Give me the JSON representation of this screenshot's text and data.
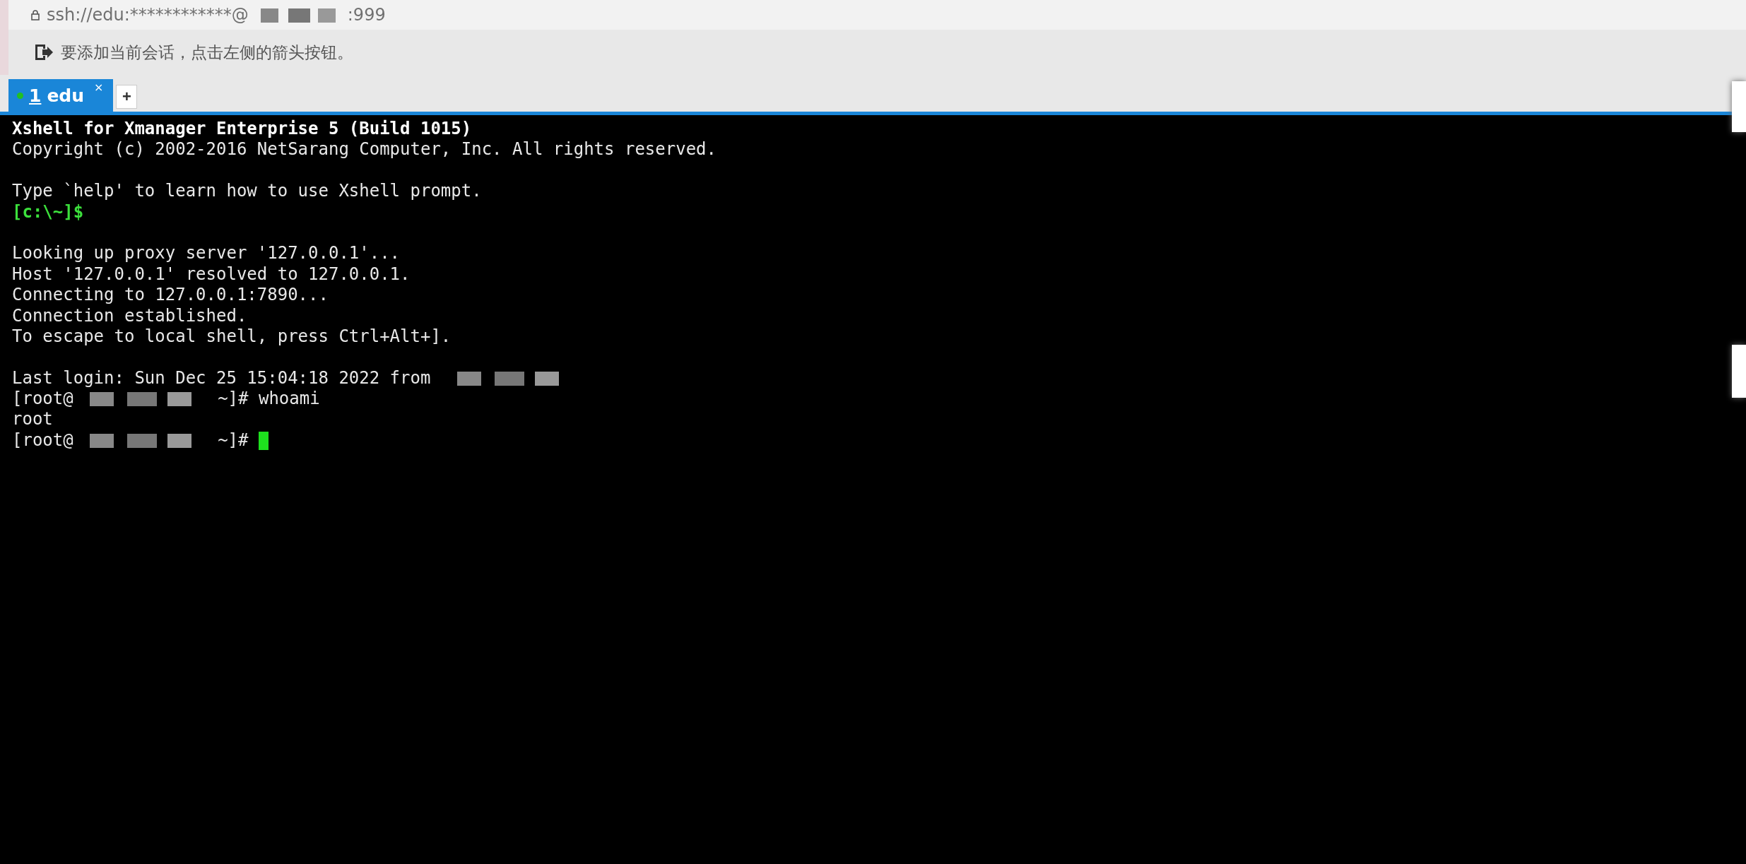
{
  "address_bar": {
    "parts": [
      {
        "kind": "text",
        "text": "ssh://edu:************@"
      },
      {
        "kind": "redacted"
      },
      {
        "kind": "text",
        "text": ":999"
      }
    ]
  },
  "session_bar": {
    "hint": "要添加当前会话，点击左侧的箭头按钮。"
  },
  "tabs": [
    {
      "number": "1",
      "label": "edu",
      "selected": true,
      "connected": true,
      "close": "×"
    }
  ],
  "new_tab_button": "+",
  "terminal": {
    "blocks": [
      {
        "lines": [
          [
            {
              "kind": "bold",
              "text": "Xshell for Xmanager Enterprise 5 (Build 1015)"
            }
          ],
          [
            {
              "kind": "plain",
              "text": "Copyright (c) 2002-2016 NetSarang Computer, Inc. All rights reserved."
            }
          ]
        ]
      },
      {
        "lines": [
          [
            {
              "kind": "plain",
              "text": "Type `help' to learn how to use Xshell prompt."
            }
          ],
          [
            {
              "kind": "green",
              "text": "[c:\\~]$"
            }
          ]
        ]
      },
      {
        "lines": [
          [
            {
              "kind": "plain",
              "text": "Looking up proxy server '127.0.0.1'..."
            }
          ],
          [
            {
              "kind": "plain",
              "text": "Host '127.0.0.1' resolved to 127.0.0.1."
            }
          ],
          [
            {
              "kind": "plain",
              "text": "Connecting to 127.0.0.1:7890..."
            }
          ],
          [
            {
              "kind": "plain",
              "text": "Connection established."
            }
          ],
          [
            {
              "kind": "plain",
              "text": "To escape to local shell, press Ctrl+Alt+]."
            }
          ]
        ]
      },
      {
        "lines": [
          [
            {
              "kind": "plain",
              "text": "Last login: Sun Dec 25 15:04:18 2022 from "
            },
            {
              "kind": "redacted"
            }
          ],
          [
            {
              "kind": "plain",
              "text": "[root@"
            },
            {
              "kind": "redacted"
            },
            {
              "kind": "plain",
              "text": " ~]# whoami"
            }
          ],
          [
            {
              "kind": "plain",
              "text": "root"
            }
          ],
          [
            {
              "kind": "plain",
              "text": "[root@"
            },
            {
              "kind": "redacted"
            },
            {
              "kind": "plain",
              "text": " ~]# "
            },
            {
              "kind": "cursor"
            }
          ]
        ]
      }
    ]
  }
}
